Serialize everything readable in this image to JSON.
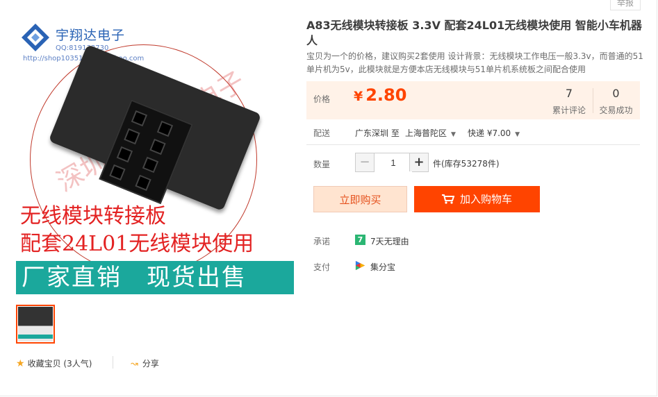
{
  "report_label": "举报",
  "image": {
    "logo_text": "宇翔达电子",
    "qq": "QQ:819133730",
    "url": "http://shop103515034.taobao.com",
    "watermark": "深圳市宇翔达电子",
    "caption_line1": "无线模块转接板",
    "caption_line2": "配套24L01无线模块使用",
    "banner": "厂家直销　现货出售"
  },
  "favorite": {
    "label": "收藏宝贝",
    "count": "(3人气)"
  },
  "share_label": "分享",
  "title": "A83无线模块转接板 3.3V 配套24L01无线模块使用 智能小车机器人",
  "subtitle": "宝贝为一个的价格，建议购买2套使用 设计背景：无线模块工作电压一般3.3v，而普通的51单片机为5v，此模块就是方便本店无线模块与51单片机系统板之间配合使用",
  "price": {
    "label": "价格",
    "currency": "¥",
    "value": "2.80"
  },
  "stats": [
    {
      "num": "7",
      "label": "累计评论"
    },
    {
      "num": "0",
      "label": "交易成功"
    }
  ],
  "shipping": {
    "label": "配送",
    "from": "广东深圳 至",
    "to": "上海普陀区",
    "method": "快递 ¥7.00"
  },
  "quantity": {
    "label": "数量",
    "value": "1",
    "minus": "−",
    "plus": "+",
    "stock": "件(库存53278件)"
  },
  "buttons": {
    "buy_now": "立即购买",
    "add_cart": "加入购物车"
  },
  "promise": {
    "label": "承诺",
    "badge": "7",
    "text": "7天无理由"
  },
  "payment": {
    "label": "支付",
    "text": "集分宝"
  },
  "colors": {
    "accent": "#ff4400",
    "price_bg": "#fff2e8",
    "banner": "#1ba89c"
  }
}
